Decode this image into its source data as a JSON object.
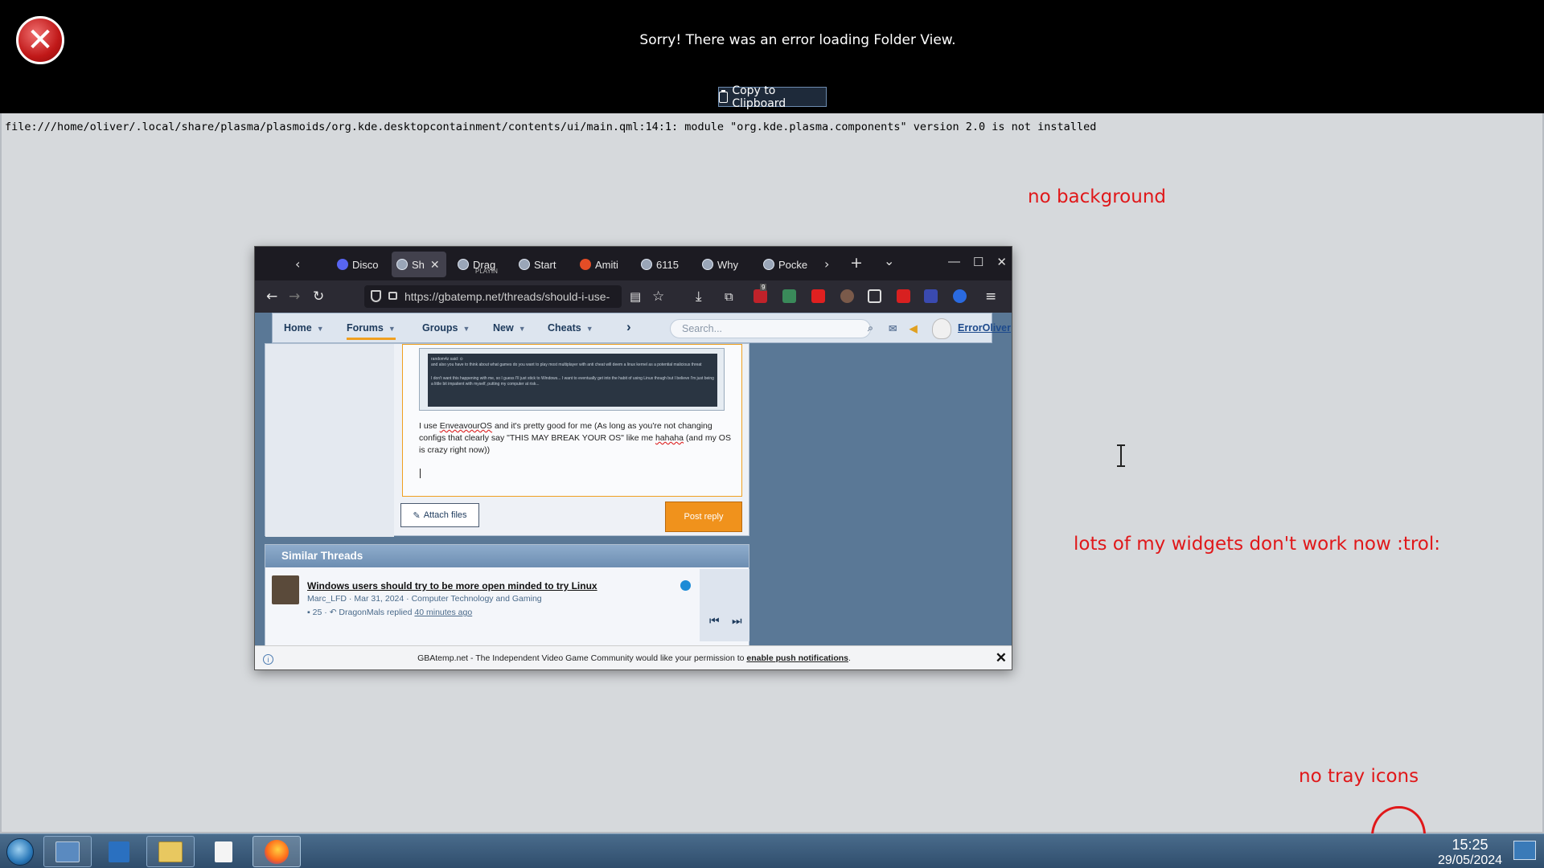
{
  "error": {
    "title": "Sorry! There was an error loading Folder View.",
    "copy_label": "Copy to Clipboard",
    "icon_glyph": "✕",
    "detail": "file:///home/oliver/.local/share/plasma/plasmoids/org.kde.desktopcontainment/contents/ui/main.qml:14:1: module \"org.kde.plasma.components\" version 2.0 is not installed"
  },
  "annotations": {
    "no_background": "no background",
    "widgets": "lots of my widgets don't work now :trol:",
    "tray": "no tray icons"
  },
  "browser": {
    "tab_prev": "‹",
    "tab_next": "›",
    "new_tab": "+",
    "tab_list": "⌄",
    "window_controls": {
      "minimize": "—",
      "maximize": "☐",
      "close": "✕"
    },
    "tabs": [
      {
        "label": "Disco",
        "icon": "discord-icon"
      },
      {
        "label": "Sh",
        "icon": "gbatemp-icon",
        "active": true
      },
      {
        "label": "Drag",
        "sub": "PLAYIN",
        "icon": "gbatemp-icon"
      },
      {
        "label": "Start",
        "icon": "gbatemp-icon"
      },
      {
        "label": "Amiti",
        "icon": "amiti-icon"
      },
      {
        "label": "6115",
        "icon": "gbatemp-icon"
      },
      {
        "label": "Why",
        "icon": "gbatemp-icon"
      },
      {
        "label": "Pocke",
        "icon": "gbatemp-icon"
      }
    ],
    "url": "https://gbatemp.net/threads/should-i-use-",
    "nav": {
      "back": "←",
      "forward": "→",
      "reload": "↻",
      "menu": "≡",
      "bookmark": "☆",
      "download": "⤓"
    },
    "badge_count": "9"
  },
  "site": {
    "nav": [
      {
        "label": "Home"
      },
      {
        "label": "Forums",
        "active": true
      },
      {
        "label": "Groups"
      },
      {
        "label": "New"
      },
      {
        "label": "Cheats"
      }
    ],
    "nav_more": "›",
    "search_placeholder": "Search...",
    "username": "ErrorOliver",
    "quote_lines": [
      "random4z said: ⊙",
      "and also you have to think about what games do you want to play most multiplayer with anti cheat will deem a linux kernel as a potential malicious threat",
      "I don't want this happening with me, so I guess I'll just stick to Windows... I want to eventually get into the habit of using Linux though but I believe I'm just being a little bit impatient with myself, putting my computer at risk..."
    ],
    "editor_text_1": "I use ",
    "editor_text_squiggle": "EnveavourOS",
    "editor_text_2": " and it's pretty good for me (As long as you're not changing configs that clearly say \"THIS MAY BREAK YOUR OS\" like me ",
    "editor_text_squiggle2": "hahaha",
    "editor_text_3": " (and my OS is crazy right now))",
    "attach_label": "Attach files",
    "post_reply_label": "Post reply",
    "similar_header": "Similar Threads",
    "thread": {
      "title": "Windows users should try to be more open minded to try Linux",
      "author": "Marc_LFD",
      "date": "Mar 31, 2024",
      "forum": "Computer Technology and Gaming",
      "replies": "25",
      "last_user": "DragonMals",
      "replied": "replied",
      "ago": "40 minutes ago"
    },
    "push": {
      "text": "GBAtemp.net - The Independent Video Game Community would like your permission to ",
      "link": "enable push notifications",
      "end": ".",
      "close": "✕",
      "info": "i"
    }
  },
  "taskbar": {
    "time": "15:25",
    "date": "29/05/2024"
  },
  "colors": {
    "annotation": "#e0181a",
    "accent": "#f0921c",
    "banner": "#000000"
  }
}
